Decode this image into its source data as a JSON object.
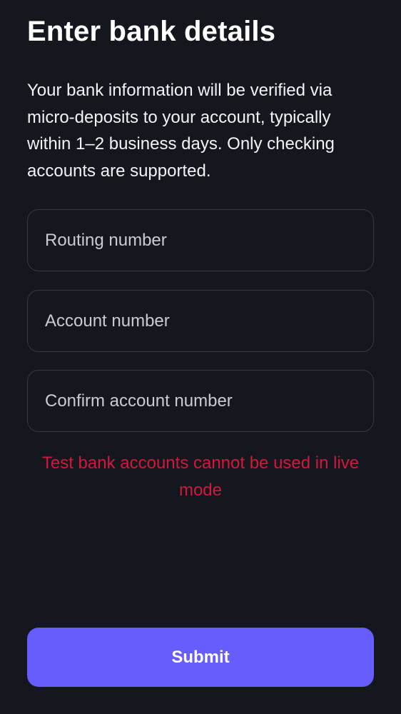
{
  "header": {
    "title": "Enter bank details"
  },
  "description": "Your bank information will be verified via micro-deposits to your account, typically within 1–2 business days. Only checking accounts are supported.",
  "form": {
    "routing_placeholder": "Routing number",
    "routing_value": "",
    "account_placeholder": "Account number",
    "account_value": "",
    "confirm_placeholder": "Confirm account number",
    "confirm_value": ""
  },
  "error": {
    "message": "Test bank accounts cannot be used in live mode"
  },
  "actions": {
    "submit_label": "Submit"
  },
  "colors": {
    "background": "#15171e",
    "field_border": "#353842",
    "error": "#d4173d",
    "accent": "#675dff"
  }
}
